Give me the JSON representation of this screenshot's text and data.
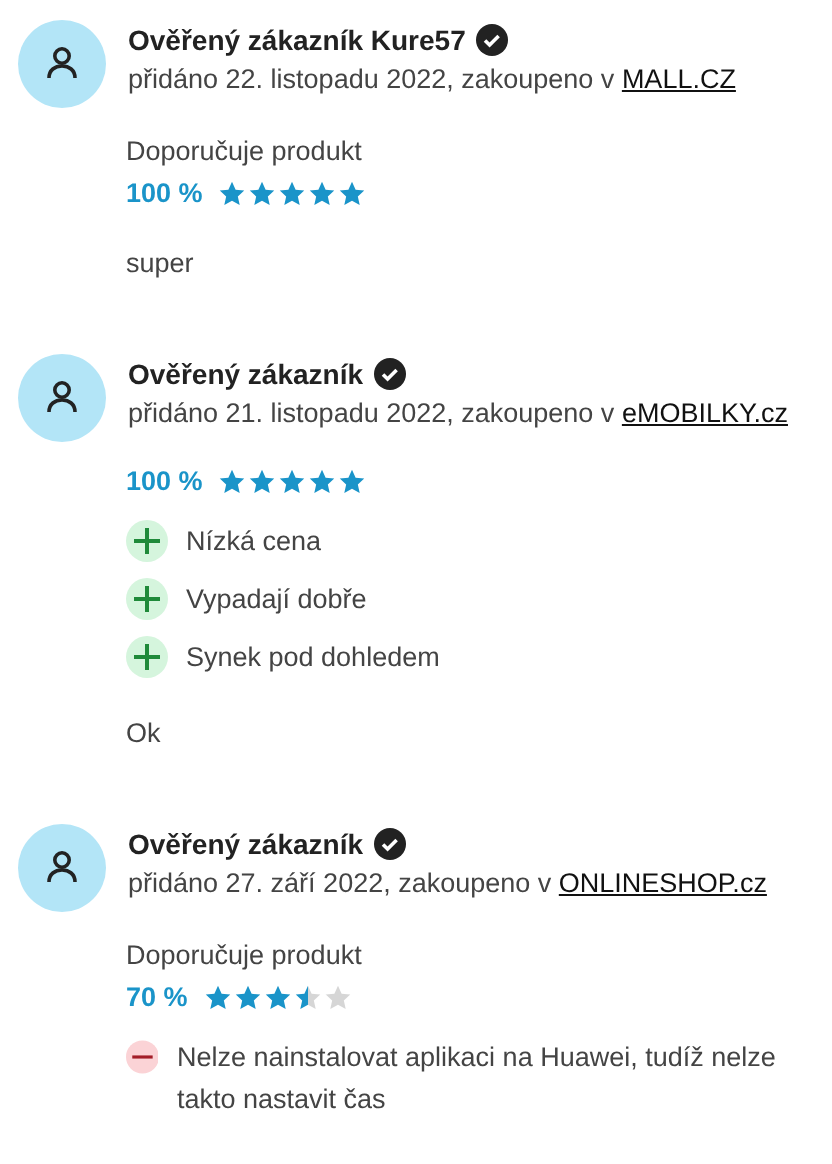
{
  "reviews": [
    {
      "author": "Ověřený zákazník Kure57",
      "verified": true,
      "meta": "přidáno 22. listopadu 2022, zakoupeno v ",
      "shop": "MALL.CZ",
      "recommends": "Doporučuje produkt",
      "percent": "100 %",
      "stars": 5,
      "comment": "super"
    },
    {
      "author": "Ověřený zákazník",
      "verified": true,
      "meta": "přidáno 21. listopadu 2022, zakoupeno v ",
      "shop": "eMOBILKY.cz",
      "percent": "100 %",
      "stars": 5,
      "points": [
        {
          "kind": "pro",
          "text": "Nízká cena"
        },
        {
          "kind": "pro",
          "text": "Vypadají dobře"
        },
        {
          "kind": "pro",
          "text": "Synek pod dohledem"
        }
      ],
      "comment": "Ok"
    },
    {
      "author": "Ověřený zákazník",
      "verified": true,
      "meta": "přidáno 27. září 2022, zakoupeno v ",
      "shop": "ONLINESHOP.cz",
      "recommends": "Doporučuje produkt",
      "percent": "70 %",
      "stars": 3.5,
      "points": [
        {
          "kind": "con",
          "text": "Nelze nainstalovat aplikaci na Huawei, tudíž nelze takto nastavit čas"
        }
      ]
    }
  ]
}
